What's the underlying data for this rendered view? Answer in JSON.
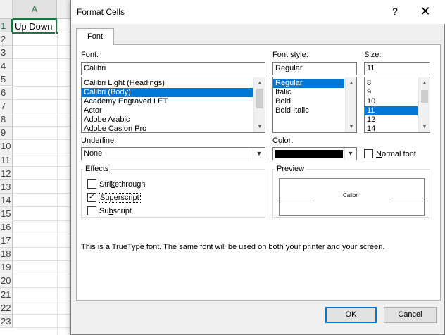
{
  "sheet": {
    "column_header": "A",
    "rows": [
      "1",
      "2",
      "3",
      "4",
      "5",
      "6",
      "7",
      "8",
      "9",
      "10",
      "11",
      "12",
      "13",
      "14",
      "15",
      "16",
      "17",
      "18",
      "19",
      "20",
      "21",
      "22",
      "23"
    ],
    "cell_a1": "Up Down"
  },
  "dialog": {
    "title": "Format Cells",
    "help": "?",
    "close": "✕",
    "tab": "Font",
    "font_label": "Font:",
    "font_value": "Calibri",
    "font_list": [
      "Calibri Light (Headings)",
      "Calibri (Body)",
      "Academy Engraved LET",
      "Actor",
      "Adobe Arabic",
      "Adobe Caslon Pro"
    ],
    "font_selected_index": 1,
    "style_label": "Font style:",
    "style_value": "Regular",
    "style_list": [
      "Regular",
      "Italic",
      "Bold",
      "Bold Italic"
    ],
    "style_selected_index": 0,
    "size_label": "Size:",
    "size_value": "11",
    "size_list": [
      "8",
      "9",
      "10",
      "11",
      "12",
      "14"
    ],
    "size_selected_index": 3,
    "underline_label": "Underline:",
    "underline_value": "None",
    "color_label": "Color:",
    "color_value": "#000000",
    "normal_font_label": "Normal font",
    "effects_label": "Effects",
    "strikethrough_label": "Strikethrough",
    "superscript_label": "Superscript",
    "subscript_label": "Subscript",
    "strikethrough_checked": false,
    "superscript_checked": true,
    "subscript_checked": false,
    "preview_label": "Preview",
    "preview_text": "Calibri",
    "footnote": "This is a TrueType font.  The same font will be used on both your printer and your screen.",
    "ok_label": "OK",
    "cancel_label": "Cancel",
    "accent_color": "#0078d7"
  }
}
